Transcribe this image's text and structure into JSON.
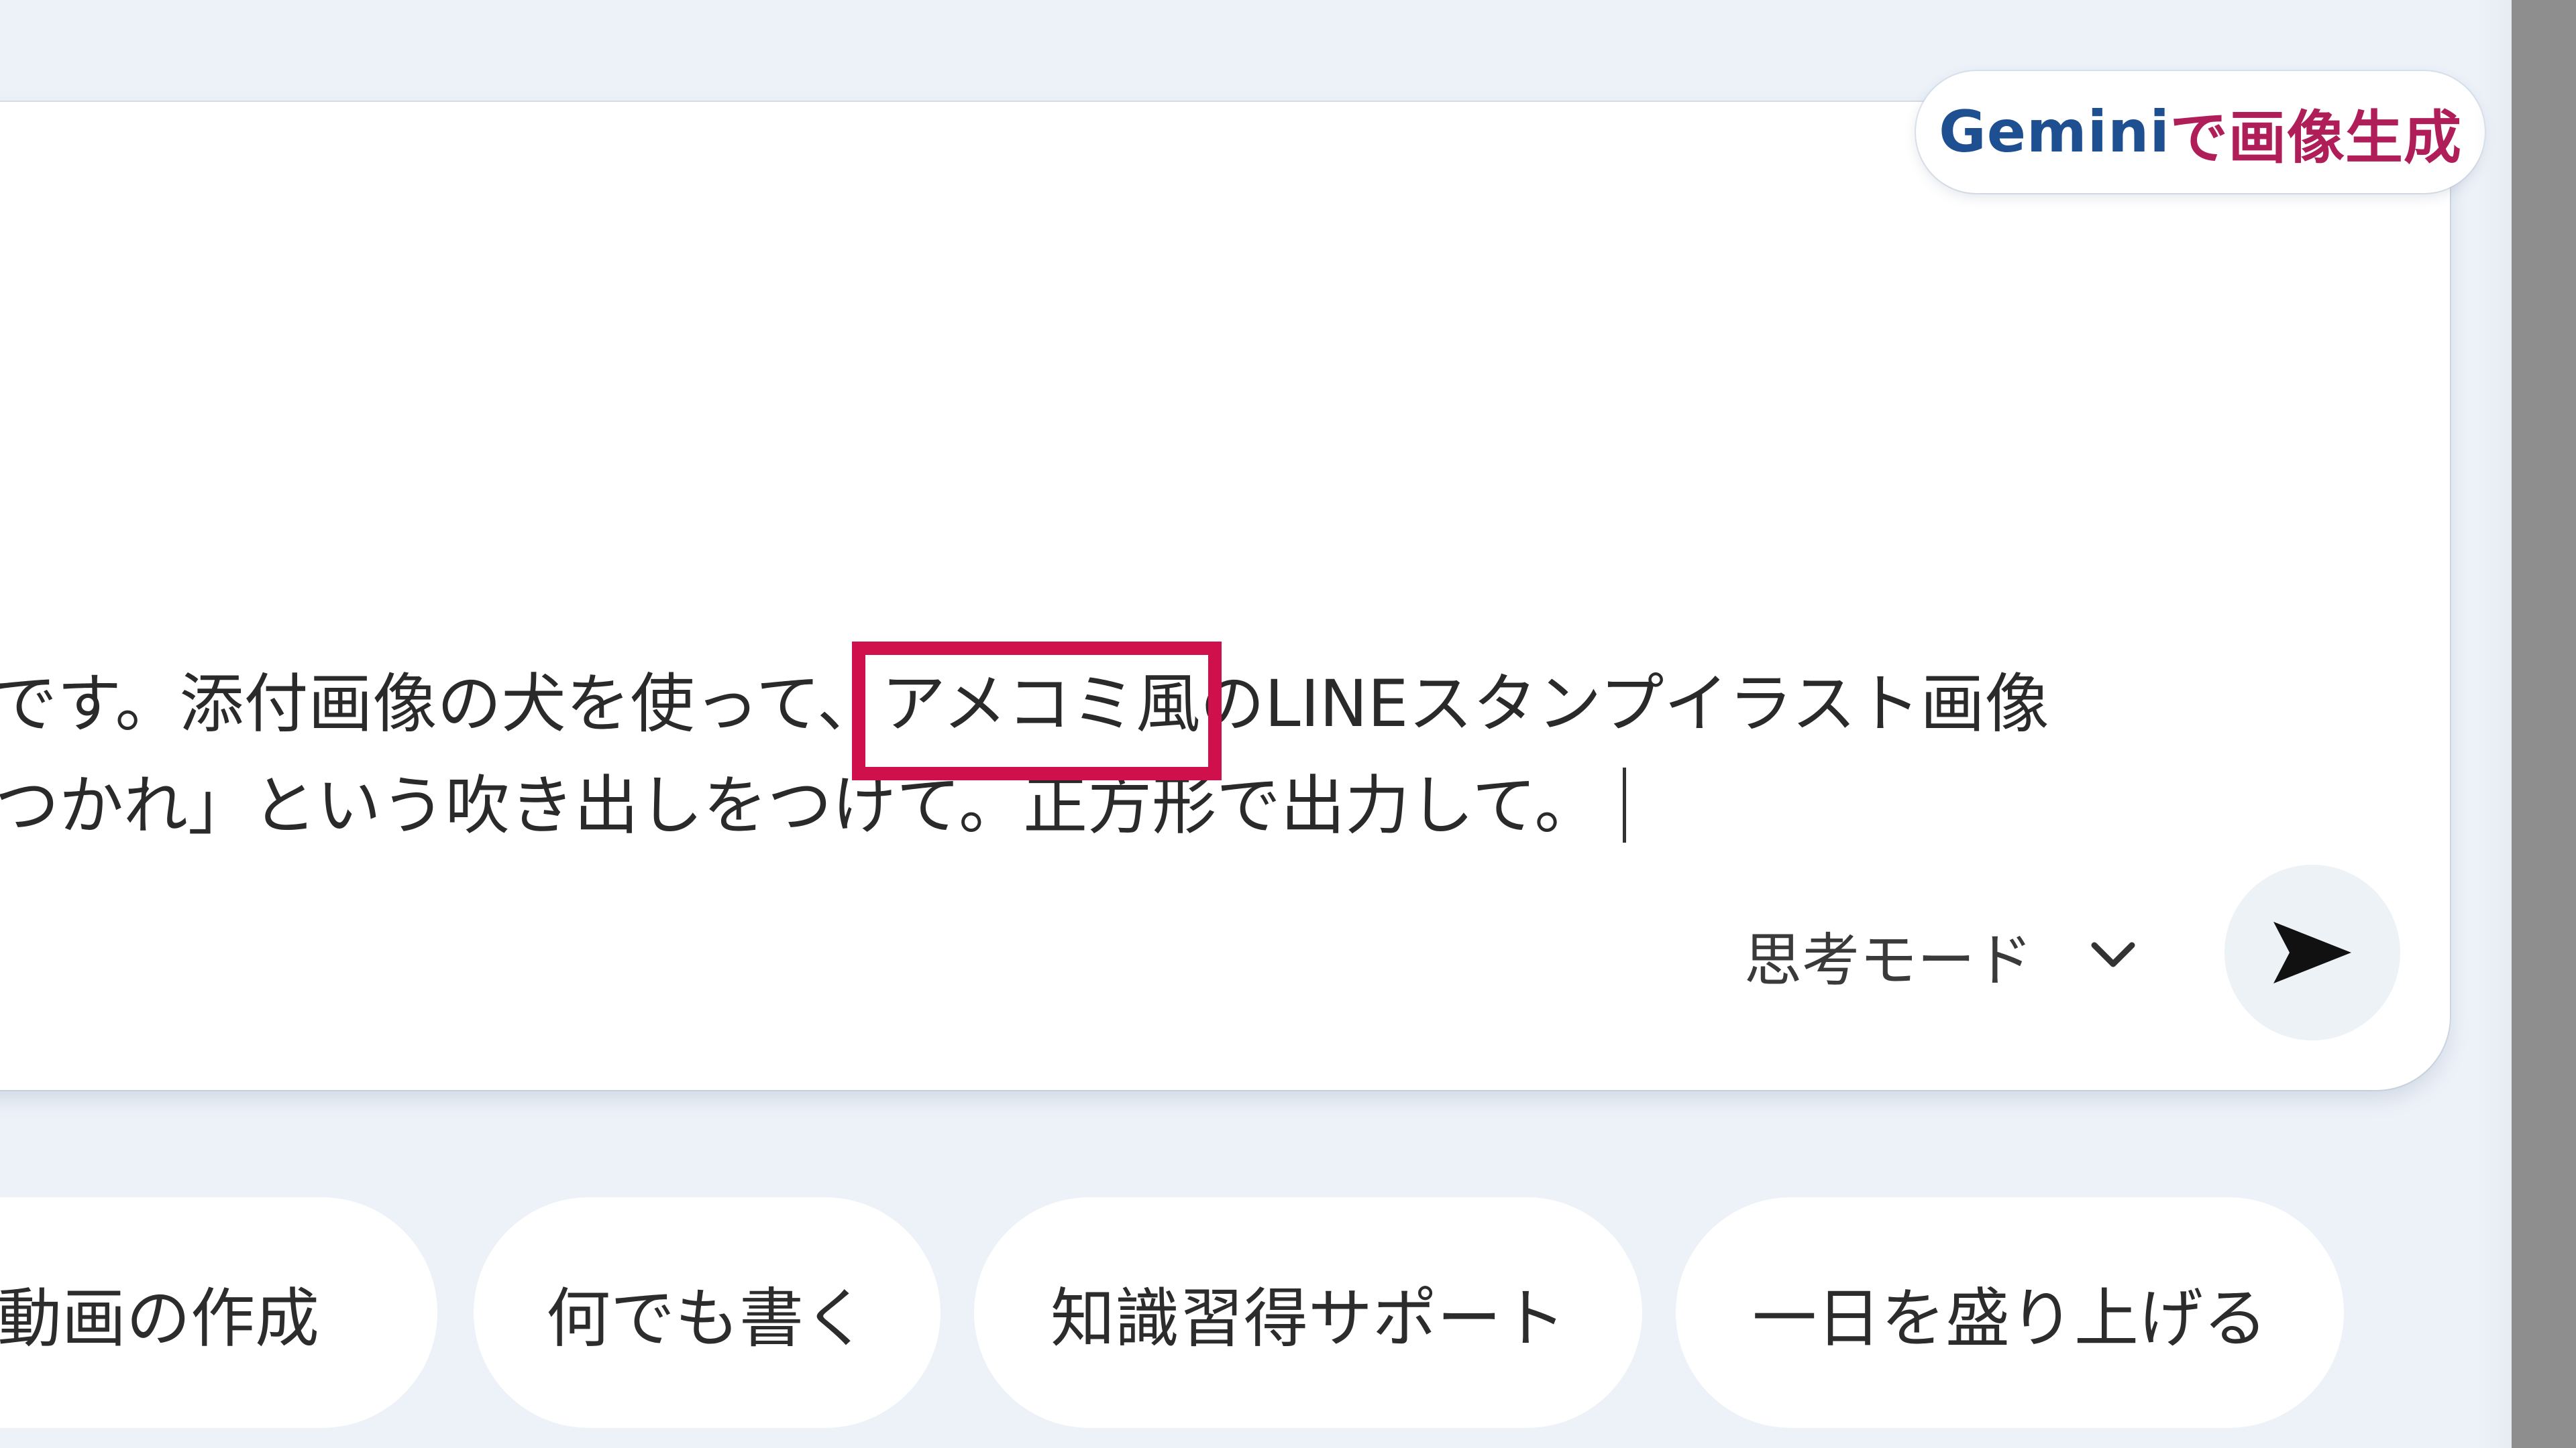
{
  "gemini_badge": {
    "part1": "Gemini",
    "part2": "で画像生成"
  },
  "prompt": {
    "line1_before": "たいです。添付画像の犬を使って、",
    "line1_highlight": "アメコミ風",
    "line1_after": "のLINEスタンプイラスト画像",
    "line2": "「おつかれ」という吹き出しをつけて。正方形で出力して。"
  },
  "mode_select": {
    "label": "思考モード",
    "icon": "chevron-down-icon"
  },
  "send_button": {
    "icon": "send-icon"
  },
  "suggestions": [
    {
      "label": "動画の作成"
    },
    {
      "label": "何でも書く"
    },
    {
      "label": "知識習得サポート"
    },
    {
      "label": "一日を盛り上げる"
    }
  ],
  "colors": {
    "highlight_border": "#d0104c",
    "gemini_blue": "#1d4f91",
    "gemini_magenta": "#b01e5a",
    "page_background": "#edf2f9"
  }
}
